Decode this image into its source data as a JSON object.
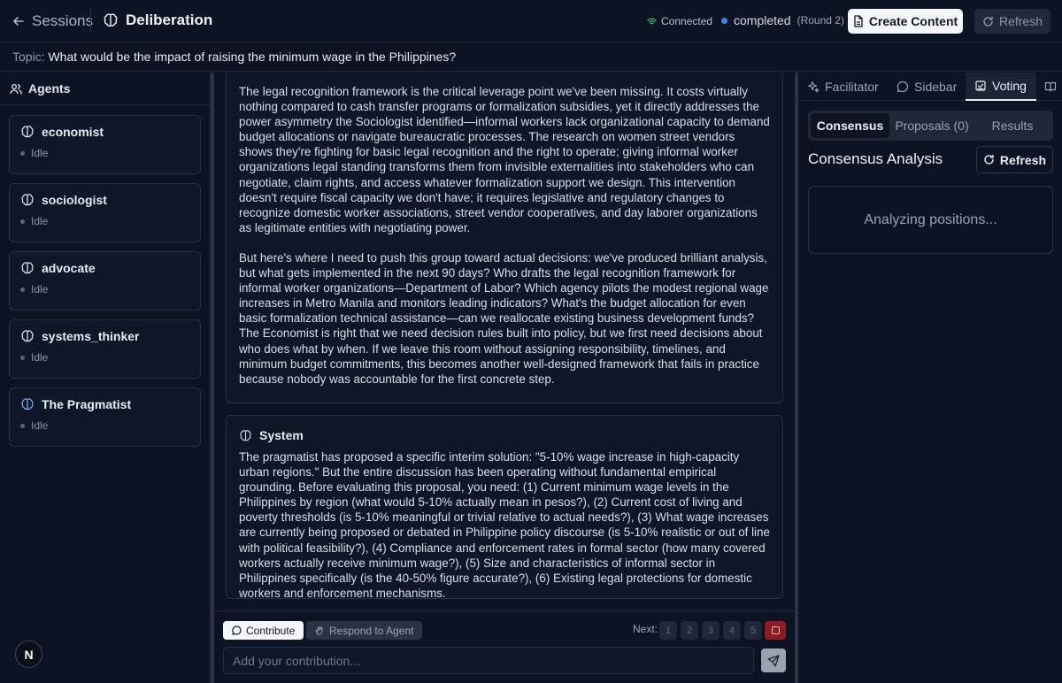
{
  "header": {
    "back_label": "Sessions",
    "app_title": "Deliberation",
    "connection": "Connected",
    "status": "completed",
    "round": "(Round 2)",
    "create_label": "Create Content",
    "refresh_label": "Refresh"
  },
  "topic": {
    "label": "Topic:",
    "text": "What would be the impact of raising the minimum wage in the Philippines?"
  },
  "agents": {
    "title": "Agents",
    "items": [
      {
        "name": "economist",
        "status": "Idle"
      },
      {
        "name": "sociologist",
        "status": "Idle"
      },
      {
        "name": "advocate",
        "status": "Idle"
      },
      {
        "name": "systems_thinker",
        "status": "Idle"
      },
      {
        "name": "The Pragmatist",
        "status": "Idle"
      }
    ]
  },
  "messages": [
    {
      "author": "",
      "paragraphs": [
        "The legal recognition framework is the critical leverage point we've been missing. It costs virtually nothing compared to cash transfer programs or formalization subsidies, yet it directly addresses the power asymmetry the Sociologist identified—informal workers lack organizational capacity to demand budget allocations or navigate bureaucratic processes. The research on women street vendors shows they're fighting for basic legal recognition and the right to operate; giving informal worker organizations legal standing transforms them from invisible externalities into stakeholders who can negotiate, claim rights, and access whatever formalization support we design. This intervention doesn't require fiscal capacity we don't have; it requires legislative and regulatory changes to recognize domestic worker associations, street vendor cooperatives, and day laborer organizations as legitimate entities with negotiating power.",
        "But here's where I need to push this group toward actual decisions: we've produced brilliant analysis, but what gets implemented in the next 90 days? Who drafts the legal recognition framework for informal worker organizations—Department of Labor? Which agency pilots the modest regional wage increases in Metro Manila and monitors leading indicators? What's the budget allocation for even basic formalization technical assistance—can we reallocate existing business development funds? The Economist is right that we need decision rules built into policy, but we first need decisions about who does what by when. If we leave this room without assigning responsibility, timelines, and minimum budget commitments, this becomes another well-designed framework that fails in practice because nobody was accountable for the first concrete step."
      ]
    },
    {
      "author": "System",
      "paragraphs": [
        "The pragmatist has proposed a specific interim solution: \"5-10% wage increase in high-capacity urban regions.\" But the entire discussion has been operating without fundamental empirical grounding. Before evaluating this proposal, you need: (1) Current minimum wage levels in the Philippines by region (what would 5-10% actually mean in pesos?), (2) Current cost of living and poverty thresholds (is 5-10% meaningful or trivial relative to actual needs?), (3) What wage increases are currently being proposed or debated in Philippine policy discourse (is 5-10% realistic or out of line with political feasibility?), (4) Compliance and enforcement rates in formal sector (how many covered workers actually receive minimum wage?), (5) Size and characteristics of informal sector in Philippines specifically (is the 40-50% figure accurate?), (6) Existing legal protections for domestic workers and enforcement mechanisms."
      ]
    }
  ],
  "compose": {
    "contribute_label": "Contribute",
    "respond_label": "Respond to Agent",
    "next_label": "Next:",
    "numbers": [
      "1",
      "2",
      "3",
      "4",
      "5"
    ],
    "placeholder": "Add your contribution..."
  },
  "right": {
    "tabs": [
      "Facilitator",
      "Sidebar",
      "Voting"
    ],
    "active_tab": "Voting",
    "subtabs": [
      "Consensus",
      "Proposals (0)",
      "Results"
    ],
    "active_subtab": "Consensus",
    "title": "Consensus Analysis",
    "refresh_label": "Refresh",
    "analyzing": "Analyzing positions..."
  },
  "logo_letter": "N",
  "colors": {
    "accent": "#3b82f6",
    "connected": "#22c55e",
    "stop": "#8b1c24"
  }
}
